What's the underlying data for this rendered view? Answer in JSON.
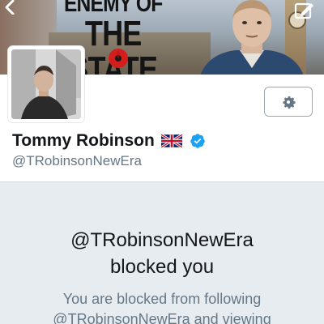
{
  "banner": {
    "headline_line1": "ENEMY OF",
    "headline_line2": "THE STATE"
  },
  "profile": {
    "display_name": "Tommy Robinson",
    "flag_icon": "uk-flag-icon",
    "verified_icon": "verified-badge-icon",
    "handle": "@TRobinsonNewEra"
  },
  "actions": {
    "settings_icon": "gear-icon"
  },
  "blocked": {
    "handle": "@TRobinsonNewEra",
    "message": "blocked you",
    "desc_line1": "You are blocked from following",
    "desc_line2": "@TRobinsonNewEra and viewing"
  },
  "colors": {
    "verified_blue": "#1da1f2",
    "panel_background": "#e6ecf0",
    "secondary_text": "#657786"
  }
}
